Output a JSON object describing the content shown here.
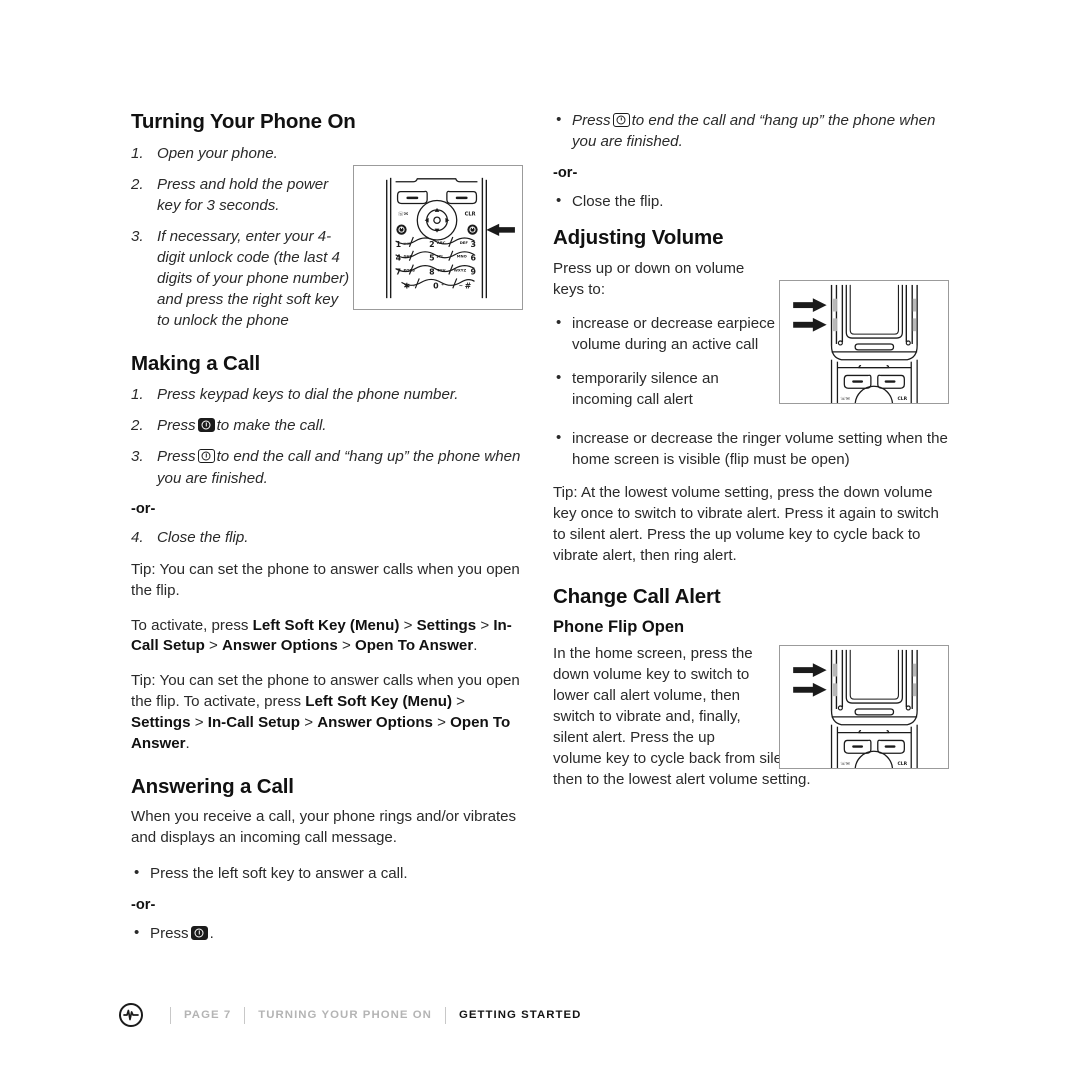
{
  "page": {
    "bg_color": "#ffffff",
    "text_color": "#2a2a2a"
  },
  "left_column": {
    "section1": {
      "heading": "Turning Your Phone On",
      "steps": [
        {
          "num": "1.",
          "text": "Open your phone."
        },
        {
          "num": "2.",
          "text": "Press and hold the power key for 3 seconds."
        },
        {
          "num": "3.",
          "text": "If necessary, enter your 4-digit unlock code (the last 4 digits of your phone number) and press the right soft key to unlock the phone"
        }
      ]
    },
    "section2": {
      "heading": "Making a Call",
      "step1_num": "1.",
      "step1_text": "Press keypad keys to dial the phone number.",
      "step2_num": "2.",
      "step2_pre": "Press",
      "step2_post": "to make the call.",
      "step2_icon": "send-key-icon",
      "step3_num": "3.",
      "step3_pre": "Press",
      "step3_post": "to end the call and “hang up” the phone when you are finished.",
      "step3_icon": "end-key-icon",
      "or_label": "-or-",
      "step4_num": "4.",
      "step4_text": "Close the flip.",
      "tip1": "Tip: You can set the phone to answer calls when you open the flip.",
      "activate1": {
        "lead": "To activate, press ",
        "b1": "Left Soft Key (Menu)",
        "s1": " > ",
        "b2": "Settings",
        "s2": " > ",
        "b3": "In-Call Setup",
        "s3": " > ",
        "b4": "Answer Options",
        "s4": " > ",
        "b5": "Open To Answer",
        "end": "."
      },
      "tip2": {
        "lead": "Tip: You can set the phone to answer calls when you open the flip. To activate, press ",
        "b1": "Left Soft Key (Menu)",
        "s1": " > ",
        "b2": "Settings",
        "s2": " > ",
        "b3": "In-Call Setup",
        "s3": " > ",
        "b4": "Answer Options",
        "s4": " > ",
        "b5": "Open To Answer",
        "end": "."
      }
    },
    "section3": {
      "heading": "Answering a Call",
      "intro": "When you receive a call, your phone rings and/or vibrates and displays an incoming call message.",
      "bullet1": "Press the left soft key to answer a call.",
      "or_label": "-or-",
      "bullet2_pre": "Press",
      "bullet2_post": ".",
      "bullet2_icon": "send-key-icon"
    }
  },
  "right_column": {
    "continued": {
      "bullet1_pre": "Press",
      "bullet1_post": "to end the call and “hang up” the phone when you are finished.",
      "bullet1_icon": "end-key-icon",
      "or_label": "-or-",
      "bullet2": "Close the flip."
    },
    "section_volume": {
      "heading": "Adjusting Volume",
      "lead": "Press up or down on volume keys to:",
      "bullets": [
        "increase or decrease earpiece volume during an active call",
        " temporarily silence an incoming call alert",
        "increase or decrease the ringer volume setting when the home screen is visible (flip must be open)"
      ],
      "tip": "Tip: At the lowest volume setting, press the down volume key once to switch to vibrate alert. Press it again to switch to silent alert. Press the up volume key to cycle back to vibrate alert, then ring alert."
    },
    "section_alert": {
      "heading": "Change Call Alert",
      "subheading": "Phone Flip Open",
      "body_narrow": "In the home screen, press the down volume key to switch to lower call alert volume, then switch to vibrate and, finally, silent alert. Press the up",
      "body_full": "volume key to cycle back from silent alert to vibrate and then to the lowest alert volume setting."
    }
  },
  "figures": {
    "keypad": {
      "name": "phone-keypad-diagram",
      "keys_row1": [
        "1",
        "2",
        "3"
      ],
      "keys_row2": [
        "4",
        "5",
        "6"
      ],
      "keys_row3": [
        "7",
        "8",
        "9"
      ],
      "keys_row4": [
        "*",
        "0",
        "#"
      ],
      "labels_row1": [
        "",
        "ABC",
        "DEF"
      ],
      "labels_row2": [
        "GHI",
        "JKL",
        "MNO"
      ],
      "labels_row3": [
        "PQRS",
        "TUV",
        "WXYZ"
      ],
      "clr_label": "CLR",
      "arrow": "power-key-arrow"
    },
    "volume": {
      "name": "phone-volume-keys-diagram",
      "arrows": 2,
      "clr_label": "CLR"
    },
    "alert": {
      "name": "phone-call-alert-diagram",
      "arrows": 2,
      "clr_label": "CLR"
    }
  },
  "footer": {
    "logo_icon": "sprint-pulse-logo-icon",
    "page_label": "PAGE 7",
    "section_label": "TURNING YOUR PHONE ON",
    "chapter_label": "GETTING STARTED",
    "muted_color": "#b4b4b4",
    "strong_color": "#141414"
  }
}
